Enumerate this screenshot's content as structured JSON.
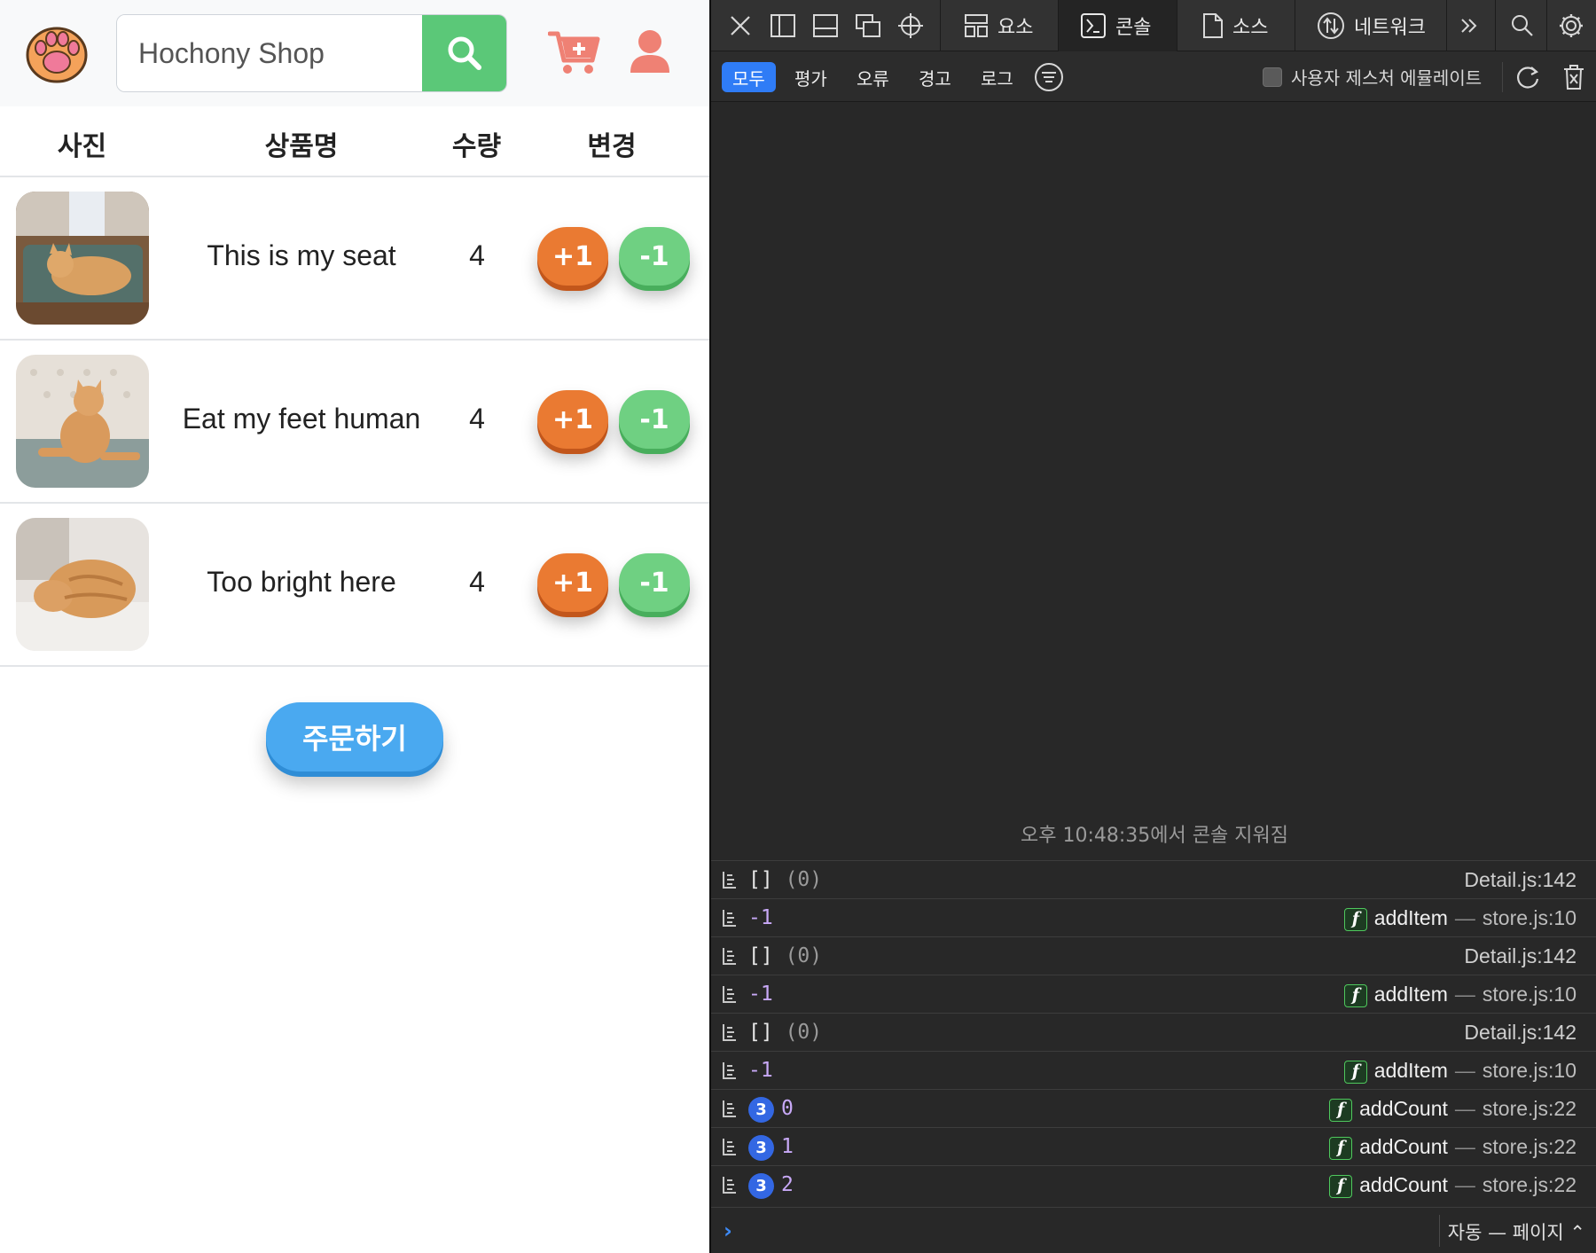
{
  "app": {
    "search": {
      "placeholder": "Hochony Shop"
    },
    "colors": {
      "plus": "#ea7a32",
      "minus": "#6fd082",
      "search": "#5bc878",
      "order": "#4aa9f0",
      "icon_accent": "#ef8174"
    },
    "table": {
      "headers": [
        "사진",
        "상품명",
        "수량",
        "변경"
      ],
      "rows": [
        {
          "name": "This is my seat",
          "qty": "4",
          "plus": "+1",
          "minus": "-1"
        },
        {
          "name": "Eat my feet human",
          "qty": "4",
          "plus": "+1",
          "minus": "-1"
        },
        {
          "name": "Too bright here",
          "qty": "4",
          "plus": "+1",
          "minus": "-1"
        }
      ]
    },
    "order_label": "주문하기"
  },
  "devtools": {
    "tabs": [
      {
        "label": "요소",
        "icon": "elements-icon"
      },
      {
        "label": "콘솔",
        "icon": "console-icon",
        "active": true
      },
      {
        "label": "소스",
        "icon": "sources-icon"
      },
      {
        "label": "네트워크",
        "icon": "network-icon"
      }
    ],
    "filters": [
      "모두",
      "평가",
      "오류",
      "경고",
      "로그"
    ],
    "emulate_label": "사용자 제스처 에뮬레이트",
    "cleared_message": "오후 10:48:35에서 콘솔 지워짐",
    "logs": [
      {
        "msg": "[]",
        "extra": "(0)",
        "source": "Detail.js:142"
      },
      {
        "msg": "-1",
        "fn": "addItem",
        "file": "store.js:10"
      },
      {
        "msg": "[]",
        "extra": "(0)",
        "source": "Detail.js:142"
      },
      {
        "msg": "-1",
        "fn": "addItem",
        "file": "store.js:10"
      },
      {
        "msg": "[]",
        "extra": "(0)",
        "source": "Detail.js:142"
      },
      {
        "msg": "-1",
        "fn": "addItem",
        "file": "store.js:10"
      },
      {
        "badge": "3",
        "msg": "0",
        "fn": "addCount",
        "file": "store.js:22"
      },
      {
        "badge": "3",
        "msg": "1",
        "fn": "addCount",
        "file": "store.js:22"
      },
      {
        "badge": "3",
        "msg": "2",
        "fn": "addCount",
        "file": "store.js:22"
      }
    ],
    "context_select": "자동 — 페이지 ⌃"
  }
}
